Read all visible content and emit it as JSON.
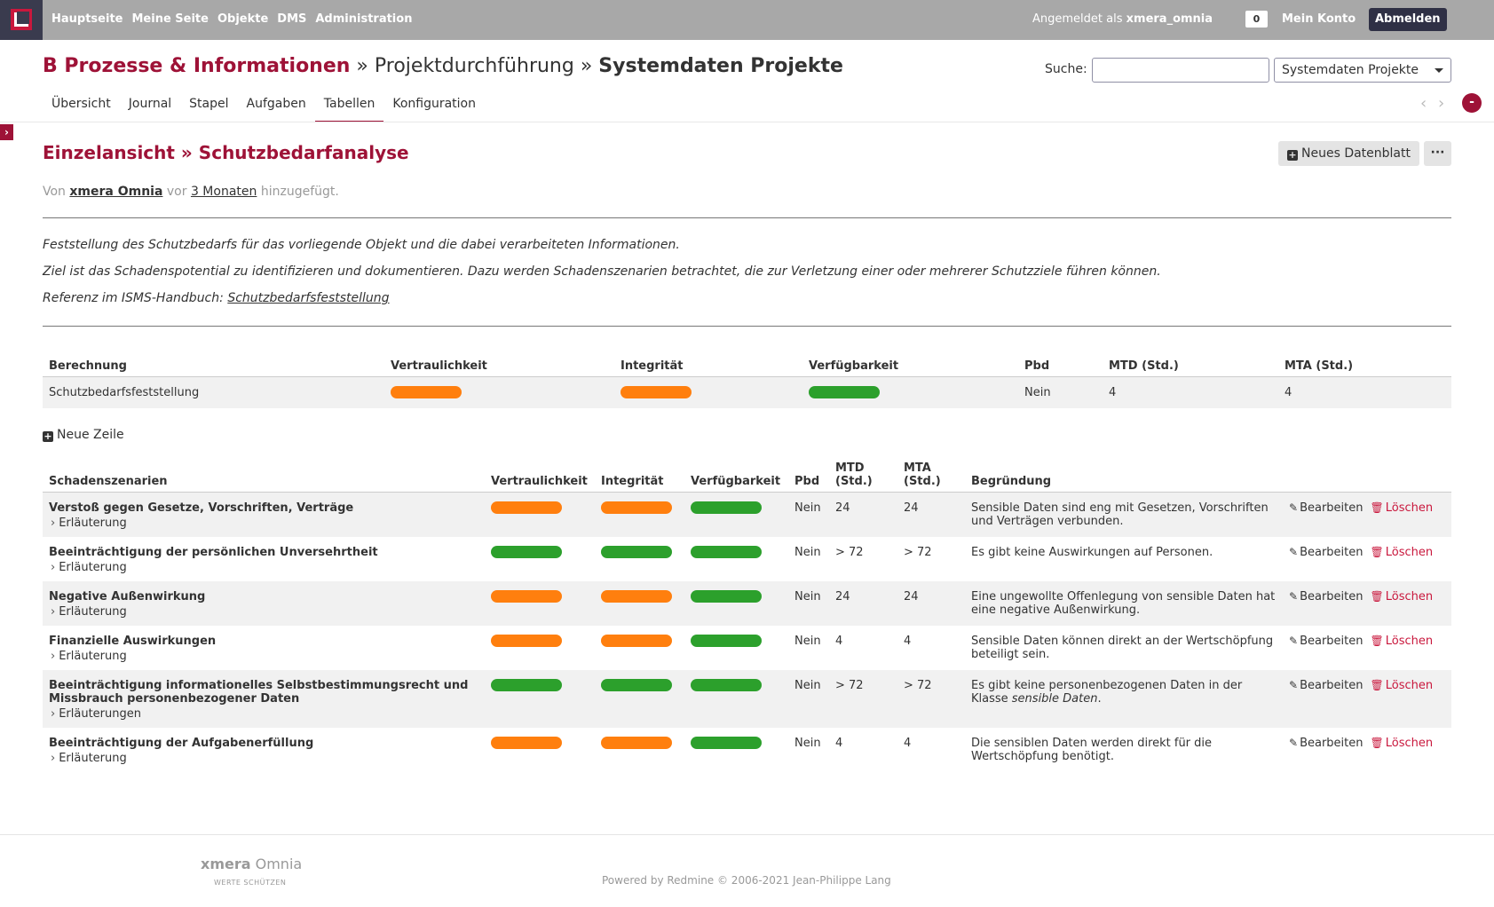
{
  "topbar": {
    "nav": [
      "Hauptseite",
      "Meine Seite",
      "Objekte",
      "DMS",
      "Administration"
    ],
    "logged_as_prefix": "Angemeldet als",
    "username": "xmera_omnia",
    "count": "0",
    "my_account": "Mein Konto",
    "logout": "Abmelden"
  },
  "header": {
    "root": "B Prozesse & Informationen",
    "sep1": " » ",
    "parent": "Projektdurchführung",
    "sep2": " » ",
    "current": "Systemdaten Projekte",
    "search_label": "Suche:",
    "search_value": "",
    "project_select": "Systemdaten Projekte"
  },
  "tabs": [
    "Übersicht",
    "Journal",
    "Stapel",
    "Aufgaben",
    "Tabellen",
    "Konfiguration"
  ],
  "selected_tab": "Tabellen",
  "page": {
    "title": "Einzelansicht » Schutzbedarfanalyse",
    "new_sheet_button": "Neues Datenblatt",
    "more_button": "···",
    "author_prefix": "Von",
    "author": "xmera Omnia",
    "author_mid": "vor",
    "age": "3 Monaten",
    "author_suffix": "hinzugefügt.",
    "description": [
      "Feststellung des Schutzbedarfs für das vorliegende Objekt und die dabei verarbeiteten Informationen.",
      "Ziel ist das Schadenspotential zu identifizieren und dokumentieren. Dazu werden Schadenszenarien betrachtet, die zur Verletzung einer oder mehrerer Schutzziele führen können."
    ],
    "reference_prefix": "Referenz im ISMS-Handbuch:",
    "reference_link": "Schutzbedarfsfeststellung"
  },
  "calc_table": {
    "headers": [
      "Berechnung",
      "Vertraulichkeit",
      "Integrität",
      "Verfügbarkeit",
      "Pbd",
      "MTD (Std.)",
      "MTA (Std.)"
    ],
    "row": {
      "name": "Schutzbedarfsfeststellung",
      "vertraulichkeit": "orange",
      "integritaet": "orange",
      "verfuegbarkeit": "green",
      "pbd": "Nein",
      "mtd": "4",
      "mta": "4"
    }
  },
  "new_row_label": "Neue Zeile",
  "scenario_table": {
    "headers": {
      "name": "Schadenszenarien",
      "vertraulichkeit": "Vertraulichkeit",
      "integritaet": "Integrität",
      "verfuegbarkeit": "Verfügbarkeit",
      "pbd": "Pbd",
      "mtd1": "MTD",
      "mtd2": "(Std.)",
      "mta1": "MTA",
      "mta2": "(Std.)",
      "begruendung": "Begründung"
    },
    "edit_label": "Bearbeiten",
    "delete_label": "Löschen",
    "rows": [
      {
        "name": "Verstoß gegen Gesetze, Vorschriften, Verträge",
        "expl": "Erläuterung",
        "v": "orange",
        "i": "orange",
        "a": "green",
        "pbd": "Nein",
        "mtd": "24",
        "mta": "24",
        "reason": "Sensible Daten sind eng mit Gesetzen, Vorschriften und Verträgen verbunden.",
        "reason_em": "",
        "reason_end": ""
      },
      {
        "name": "Beeinträchtigung der persönlichen Unversehrtheit",
        "expl": "Erläuterung",
        "v": "green",
        "i": "green",
        "a": "green",
        "pbd": "Nein",
        "mtd": "> 72",
        "mta": "> 72",
        "reason": "Es gibt keine Auswirkungen auf Personen.",
        "reason_em": "",
        "reason_end": ""
      },
      {
        "name": "Negative Außenwirkung",
        "expl": "Erläuterung",
        "v": "orange",
        "i": "orange",
        "a": "green",
        "pbd": "Nein",
        "mtd": "24",
        "mta": "24",
        "reason": "Eine ungewollte Offenlegung von sensible Daten hat eine negative Außenwirkung.",
        "reason_em": "",
        "reason_end": ""
      },
      {
        "name": "Finanzielle Auswirkungen",
        "expl": "Erläuterung",
        "v": "orange",
        "i": "orange",
        "a": "green",
        "pbd": "Nein",
        "mtd": "4",
        "mta": "4",
        "reason": "Sensible Daten können direkt an der Wertschöpfung beteiligt sein.",
        "reason_em": "",
        "reason_end": ""
      },
      {
        "name": "Beeinträchtigung informationelles Selbstbestimmungsrecht und Missbrauch personenbezogener Daten",
        "expl": "Erläuterungen",
        "v": "green",
        "i": "green",
        "a": "green",
        "pbd": "Nein",
        "mtd": "> 72",
        "mta": "> 72",
        "reason": "Es gibt keine personenbezogenen Daten in der Klasse ",
        "reason_em": "sensible Daten",
        "reason_end": "."
      },
      {
        "name": "Beeinträchtigung der Aufgabenerfüllung",
        "expl": "Erläuterung",
        "v": "orange",
        "i": "orange",
        "a": "green",
        "pbd": "Nein",
        "mtd": "4",
        "mta": "4",
        "reason": "Die sensiblen Daten werden direkt für die Wertschöpfung benötigt.",
        "reason_em": "",
        "reason_end": ""
      }
    ]
  },
  "colors": {
    "orange": "#ff7f0e",
    "green": "#2ca02c",
    "accent": "#9e1237"
  },
  "footer": {
    "brand_bold": "xmera",
    "brand_rest": " Omnia",
    "tagline": "WERTE SCHÜTZEN",
    "powered": "Powered by Redmine © 2006-2021 Jean-Philippe Lang"
  }
}
